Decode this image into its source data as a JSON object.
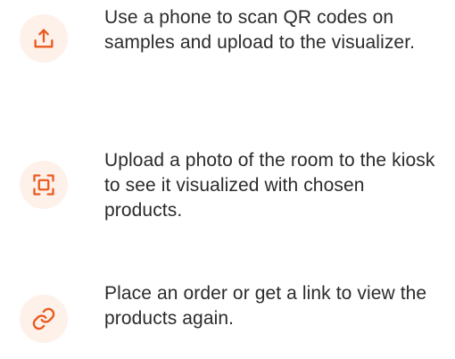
{
  "colors": {
    "accent": "#ea5b1f",
    "icon_background": "#fdf1ea",
    "text": "#2b2b2b",
    "background": "#ffffff"
  },
  "features": [
    {
      "icon": "upload-icon",
      "text": "Use a phone to scan QR codes on samples and upload to the visualizer."
    },
    {
      "icon": "scan-frame-icon",
      "text": "Upload a photo of the room to the kiosk to see it visualized with chosen products."
    },
    {
      "icon": "link-icon",
      "text": "Place an order or get a link to view the products again."
    }
  ]
}
